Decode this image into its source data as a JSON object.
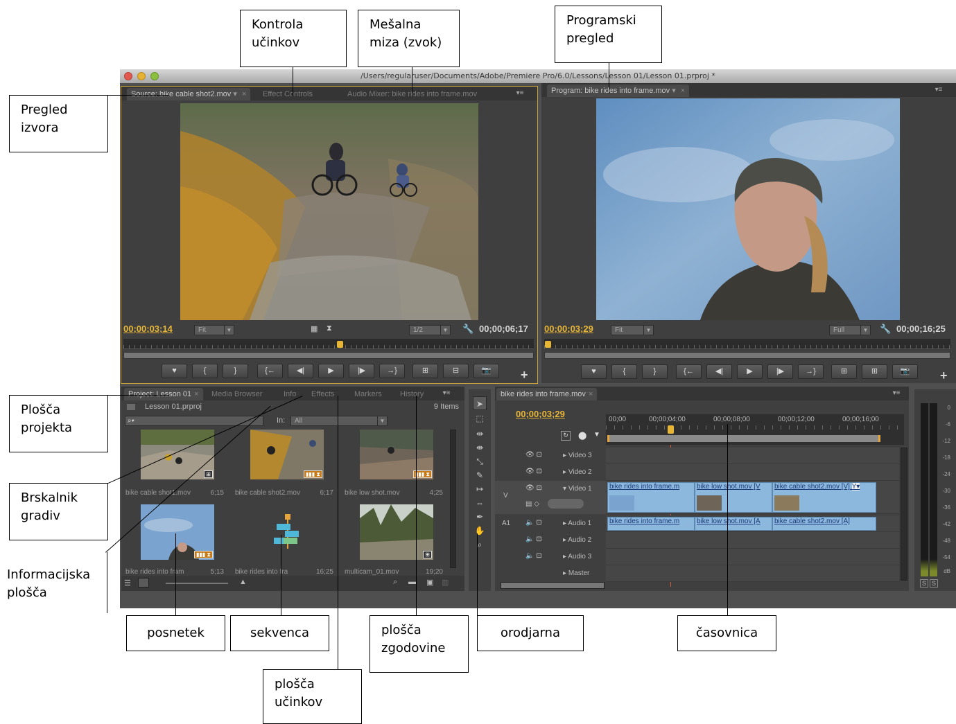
{
  "window": {
    "title": "/Users/regularuser/Documents/Adobe/Premiere Pro/6.0/Lessons/Lesson 01/Lesson 01.prproj *"
  },
  "source_panel": {
    "tabs": [
      "Source: bike cable shot2.mov",
      "Effect Controls",
      "Audio Mixer: bike rides into frame.mov"
    ],
    "current_time": "00;00;03;14",
    "duration": "00;00;06;17",
    "zoom": "Fit",
    "resolution": "1/2",
    "buttons": [
      "♥",
      "{",
      "}",
      "{←",
      "◀|",
      "▶",
      "|▶",
      "→}",
      "⊞",
      "⊟",
      "📷"
    ]
  },
  "program_panel": {
    "tab": "Program: bike rides into frame.mov",
    "current_time": "00;00;03;29",
    "duration": "00;00;16;25",
    "zoom": "Fit",
    "resolution": "Full",
    "buttons": [
      "♥",
      "{",
      "}",
      "{←",
      "◀|",
      "▶",
      "|▶",
      "→}",
      "⊞",
      "⊞",
      "📷"
    ]
  },
  "project_panel": {
    "tabs": [
      "Project: Lesson 01",
      "Media Browser",
      "Info",
      "Effects",
      "Markers",
      "History"
    ],
    "file": "Lesson 01.prproj",
    "item_count": "9 Items",
    "in_label": "In:",
    "in_value": "All",
    "items": [
      {
        "name": "bike cable shot1.mov",
        "duration": "6;15"
      },
      {
        "name": "bike cable shot2.mov",
        "duration": "6;17"
      },
      {
        "name": "bike low shot.mov",
        "duration": "4;25"
      },
      {
        "name": "bike rides into fram",
        "duration": "5;13"
      },
      {
        "name": "bike rides into fra",
        "duration": "16;25"
      },
      {
        "name": "multicam_01.mov",
        "duration": "19;20"
      }
    ]
  },
  "timeline": {
    "tab": "bike rides into frame.mov",
    "current_time": "00;00;03;29",
    "ruler": [
      "00;00",
      "00;00;04;00",
      "00;00;08;00",
      "00;00;12;00",
      "00;00;16;00"
    ],
    "tracks": {
      "video3": "Video 3",
      "video2": "Video 2",
      "video1": "Video 1",
      "audio1": "Audio 1",
      "audio2": "Audio 2",
      "audio3": "Audio 3",
      "master": "Master"
    },
    "track_tags": {
      "v": "V",
      "a1": "A1"
    },
    "video_clips": [
      "bike rides into frame.m",
      "bike low shot.mov [V",
      "bike cable shot2.mov [V]",
      "Y▾"
    ],
    "audio_clips": [
      "bike rides into frame.m",
      "bike low shot.mov [A",
      "bike cable shot2.mov [A]"
    ]
  },
  "meter": {
    "scale": [
      "0",
      "-6",
      "-12",
      "-18",
      "-24",
      "-30",
      "-36",
      "-42",
      "-48",
      "-54",
      "dB"
    ],
    "solo": [
      "S",
      "S"
    ]
  },
  "callouts": {
    "kontrola": [
      "Kontrola",
      "učinkov"
    ],
    "mesalna": [
      "Mešalna",
      "miza (zvok)"
    ],
    "programski": [
      "Programski",
      "pregled"
    ],
    "pregled_izvora": [
      "Pregled",
      "izvora"
    ],
    "plosca_projekta": [
      "Plošča",
      "projekta"
    ],
    "brskalnik": [
      "Brskalnik",
      "gradiv"
    ],
    "informacijska": [
      "Informacijska",
      "plošča"
    ],
    "posnetek": "posnetek",
    "sekvenca": "sekvenca",
    "zgodovine": [
      "plošča",
      "zgodovine"
    ],
    "orodjarna": "orodjarna",
    "casovnica": "časovnica",
    "ucinkov": [
      "plošča",
      "učinkov"
    ]
  }
}
